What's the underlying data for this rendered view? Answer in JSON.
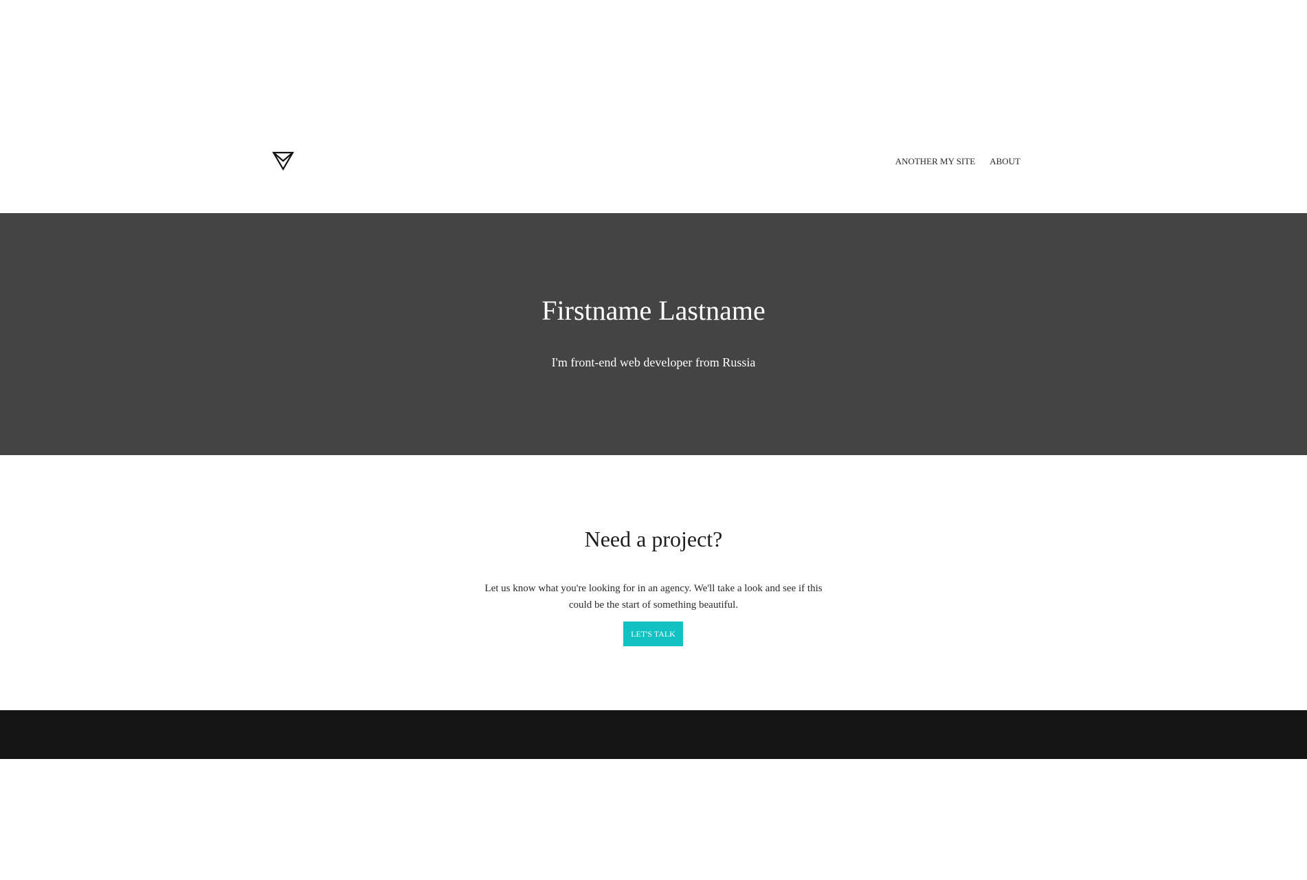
{
  "header": {
    "logo_icon": "triangle-logo-icon",
    "nav": [
      {
        "label": "ANOTHER MY SITE"
      },
      {
        "label": "ABOUT"
      }
    ]
  },
  "hero": {
    "title": "Firstname Lastname",
    "subtitle": "I'm front-end web developer from Russia",
    "background_color": "#444444"
  },
  "cta": {
    "title": "Need a project?",
    "text": "Let us know what you're looking for in an agency. We'll take a look and see if this could be the start of something beautiful.",
    "button_label": "LET'S TALK",
    "button_color": "#12c2c2"
  },
  "footer": {
    "background_color": "#141414"
  }
}
